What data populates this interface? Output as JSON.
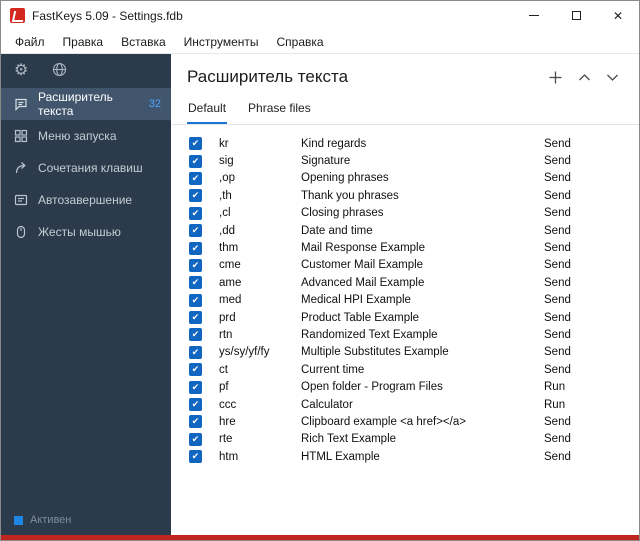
{
  "window": {
    "title": "FastKeys 5.09  - Settings.fdb"
  },
  "icons": {
    "close": "✕",
    "gear": "⚙",
    "check": "✔"
  },
  "menu": {
    "items": [
      "Файл",
      "Правка",
      "Вставка",
      "Инструменты",
      "Справка"
    ]
  },
  "sidebar": {
    "items": [
      {
        "label": "Расширитель текста",
        "badge": "32"
      },
      {
        "label": "Меню запуска"
      },
      {
        "label": "Сочетания клавиш"
      },
      {
        "label": "Автозавершение"
      },
      {
        "label": "Жесты мышью"
      }
    ],
    "status": {
      "label": "Активен"
    }
  },
  "main": {
    "title": "Расширитель текста",
    "tabs": [
      {
        "label": "Default"
      },
      {
        "label": "Phrase files"
      }
    ],
    "rows": [
      {
        "checked": true,
        "shortcut": "kr",
        "description": "Kind regards",
        "action": "Send"
      },
      {
        "checked": true,
        "shortcut": "sig",
        "description": "Signature",
        "action": "Send"
      },
      {
        "checked": true,
        "shortcut": ",op",
        "description": "Opening phrases",
        "action": "Send"
      },
      {
        "checked": true,
        "shortcut": ",th",
        "description": "Thank you phrases",
        "action": "Send"
      },
      {
        "checked": true,
        "shortcut": ",cl",
        "description": "Closing phrases",
        "action": "Send"
      },
      {
        "checked": true,
        "shortcut": ",dd",
        "description": "Date and time",
        "action": "Send"
      },
      {
        "checked": true,
        "shortcut": "thm",
        "description": "Mail Response Example",
        "action": "Send"
      },
      {
        "checked": true,
        "shortcut": "cme",
        "description": "Customer Mail Example",
        "action": "Send"
      },
      {
        "checked": true,
        "shortcut": "ame",
        "description": "Advanced Mail Example",
        "action": "Send"
      },
      {
        "checked": true,
        "shortcut": "med",
        "description": "Medical HPI Example",
        "action": "Send"
      },
      {
        "checked": true,
        "shortcut": "prd",
        "description": "Product Table Example",
        "action": "Send"
      },
      {
        "checked": true,
        "shortcut": "rtn",
        "description": "Randomized Text Example",
        "action": "Send"
      },
      {
        "checked": true,
        "shortcut": "ys/sy/yf/fy",
        "description": "Multiple Substitutes Example",
        "action": "Send"
      },
      {
        "checked": true,
        "shortcut": "ct",
        "description": "Current time",
        "action": "Send"
      },
      {
        "checked": true,
        "shortcut": "pf",
        "description": "Open folder - Program Files",
        "action": "Run"
      },
      {
        "checked": true,
        "shortcut": "ccc",
        "description": "Calculator",
        "action": "Run"
      },
      {
        "checked": true,
        "shortcut": "hre",
        "description": "Clipboard example <a href></a>",
        "action": "Send"
      },
      {
        "checked": true,
        "shortcut": "rte",
        "description": "Rich Text Example",
        "action": "Send"
      },
      {
        "checked": true,
        "shortcut": "htm",
        "description": "HTML Example",
        "action": "Send"
      }
    ]
  }
}
